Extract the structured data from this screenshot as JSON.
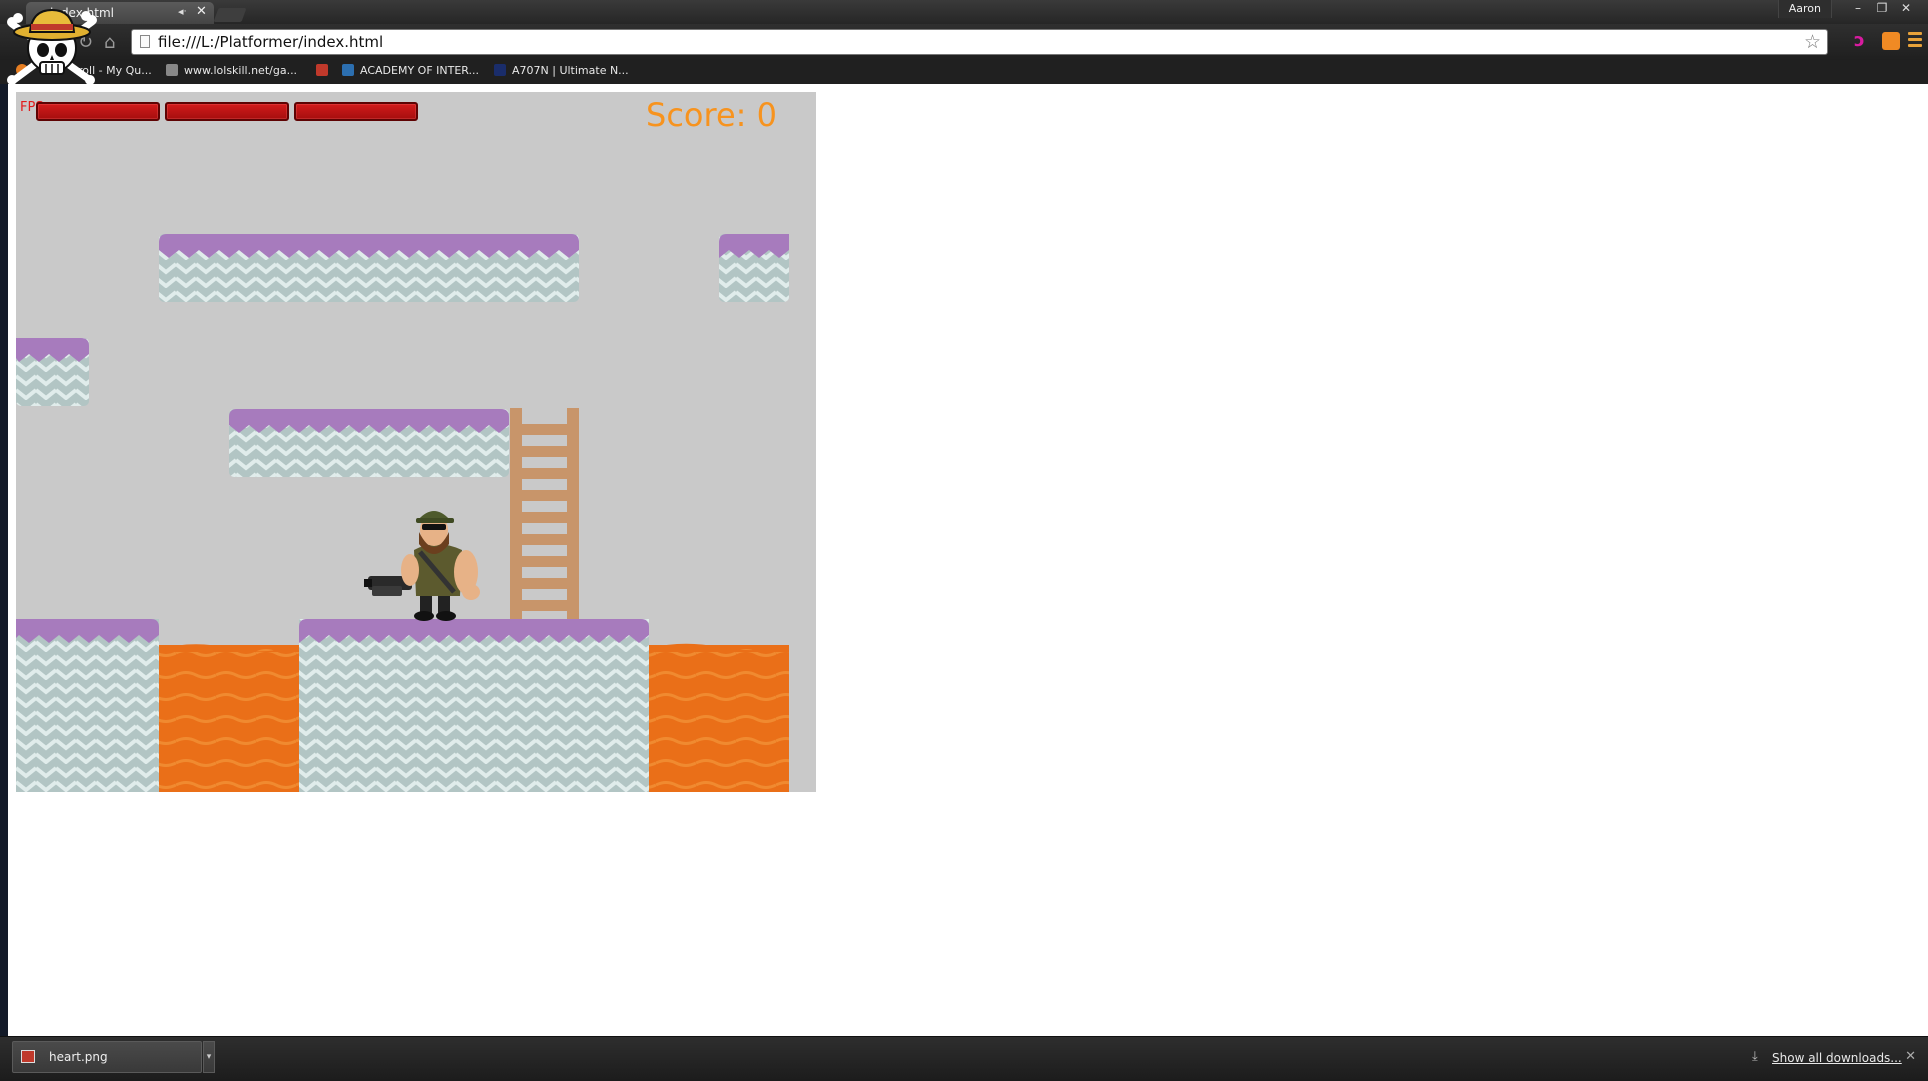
{
  "tab": {
    "title": "index.html",
    "mute_icon": "speaker-icon",
    "close_glyph": "✕"
  },
  "user": {
    "name": "Aaron"
  },
  "window_controls": {
    "minimize": "–",
    "maximize": "❐",
    "close": "✕"
  },
  "toolbar": {
    "url": "file:///L:/Platformer/index.html"
  },
  "bookmarks": [
    {
      "label": "roll - My Qu...",
      "color": "#e67e22"
    },
    {
      "label": "www.lolskill.net/ga...",
      "color": "#888888"
    },
    {
      "label": "",
      "color": "#c0392b"
    },
    {
      "label": "ACADEMY OF INTER...",
      "color": "#2c6fb0"
    },
    {
      "label": "A707N | Ultimate N...",
      "color": "#1a2d6b"
    }
  ],
  "game": {
    "fps_label": "FPS",
    "health_bars": 3,
    "score_label": "Score: 0",
    "colors": {
      "sky": "#c9c9c9",
      "platform_top": "#a77bbd",
      "platform_body": "#b2c5c4",
      "lava": "#ea6f18",
      "ladder": "#c8956a",
      "score": "#f7931e",
      "health": "#c41515"
    }
  },
  "downloads": {
    "item_name": "heart.png",
    "show_all": "Show all downloads...",
    "close_glyph": "✕"
  }
}
